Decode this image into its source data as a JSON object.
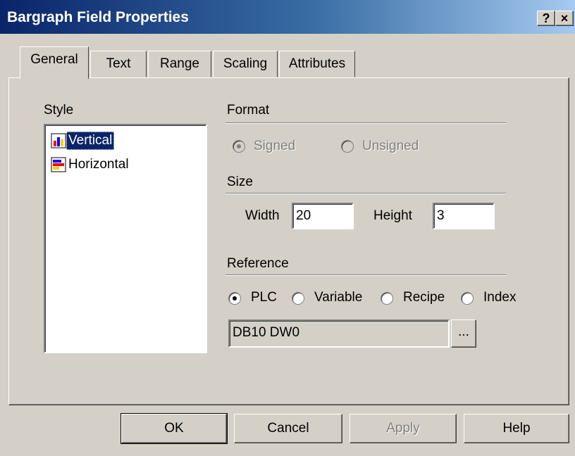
{
  "window": {
    "title": "Bargraph Field Properties",
    "help_glyph": "?",
    "close_glyph": "×"
  },
  "tabs": [
    {
      "label": "General",
      "active": true
    },
    {
      "label": "Text"
    },
    {
      "label": "Range"
    },
    {
      "label": "Scaling"
    },
    {
      "label": "Attributes"
    }
  ],
  "style": {
    "label": "Style",
    "items": [
      {
        "label": "Vertical",
        "icon": "vertical-bargraph-icon",
        "selected": true
      },
      {
        "label": "Horizontal",
        "icon": "horizontal-bargraph-icon"
      }
    ]
  },
  "format": {
    "label": "Format",
    "options": [
      {
        "label": "Signed",
        "checked": true,
        "enabled": false
      },
      {
        "label": "Unsigned",
        "checked": false,
        "enabled": false
      }
    ]
  },
  "size": {
    "label": "Size",
    "width_label": "Width",
    "width_value": "20",
    "height_label": "Height",
    "height_value": "3"
  },
  "reference": {
    "label": "Reference",
    "options": [
      {
        "label": "PLC",
        "checked": true
      },
      {
        "label": "Variable"
      },
      {
        "label": "Recipe"
      },
      {
        "label": "Index"
      }
    ],
    "address_value": "DB10 DW0",
    "browse_label": "..."
  },
  "buttons": {
    "ok": "OK",
    "cancel": "Cancel",
    "apply": "Apply",
    "help": "Help"
  },
  "colors": {
    "title_start": "#0a246a",
    "title_end": "#a6caf0",
    "face": "#d4d0c8",
    "selection": "#0a246a"
  }
}
